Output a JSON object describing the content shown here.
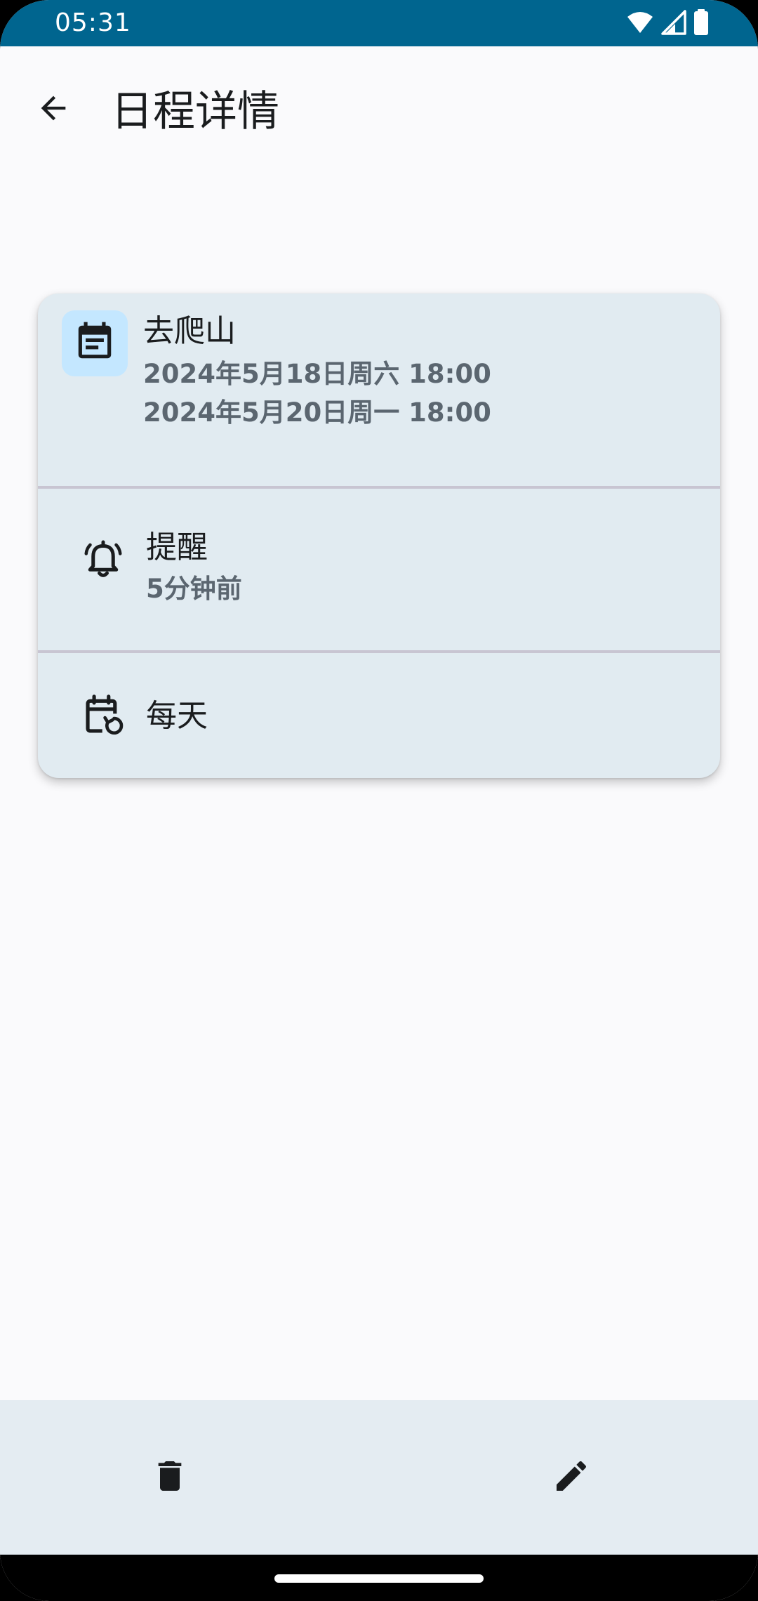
{
  "status_bar": {
    "time": "05:31",
    "icons": [
      "wifi-icon",
      "signal-icon",
      "battery-icon"
    ],
    "background": "#00658f"
  },
  "app_bar": {
    "back_icon": "arrow-back-icon",
    "title": "日程详情"
  },
  "event": {
    "icon": "event-note-icon",
    "title": "去爬山",
    "start": "2024年5月18日周六 18:00",
    "end": "2024年5月20日周一 18:00"
  },
  "reminder": {
    "icon": "alarm-bell-icon",
    "title": "提醒",
    "value": "5分钟前"
  },
  "repeat": {
    "icon": "event-repeat-icon",
    "label": "每天"
  },
  "bottom_bar": {
    "delete_icon": "delete-icon",
    "edit_icon": "edit-icon"
  },
  "colors": {
    "card": "#e1ebf1",
    "icon_bg": "#c4e7ff",
    "primary_text": "#1a1c1e",
    "secondary_text": "#5b6670"
  }
}
